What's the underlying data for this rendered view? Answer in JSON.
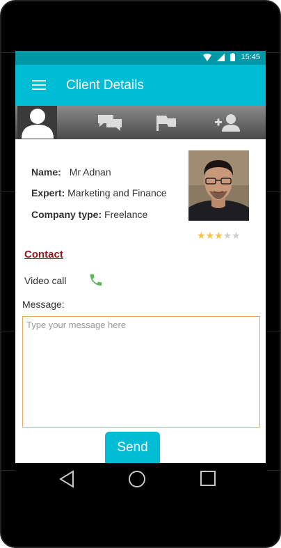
{
  "status_bar": {
    "time": "15:45",
    "icons": [
      "wifi-icon",
      "signal-icon",
      "battery-icon"
    ]
  },
  "app_bar": {
    "title": "Client Details",
    "menu_icon": "hamburger-menu-icon",
    "background": "#00bcd4"
  },
  "tabs": [
    {
      "icon": "profile-icon",
      "active": true
    },
    {
      "icon": "chat-icon",
      "active": false
    },
    {
      "icon": "flag-icon",
      "active": false
    },
    {
      "icon": "add-person-icon",
      "active": false
    }
  ],
  "client": {
    "name_label": "Name:",
    "name_value": "Mr Adnan",
    "expert_label": "Expert:",
    "expert_value": "Marketing and Finance",
    "company_label": "Company type:",
    "company_value": "Freelance",
    "rating": 3,
    "rating_max": 5
  },
  "contact": {
    "heading": "Contact",
    "video_call_label": "Video call",
    "phone_icon": "phone-icon"
  },
  "message": {
    "label": "Message:",
    "placeholder": "Type your message here",
    "value": ""
  },
  "send_button": {
    "label": "Send"
  },
  "nav_bar": [
    "back-icon",
    "home-icon",
    "recents-icon"
  ],
  "colors": {
    "accent": "#00bcd4",
    "status_bar": "#0097a7",
    "contact_heading": "#8b1a1a",
    "phone": "#5cb85c",
    "star_on": "#f5c342",
    "star_off": "#cfcfcf"
  }
}
